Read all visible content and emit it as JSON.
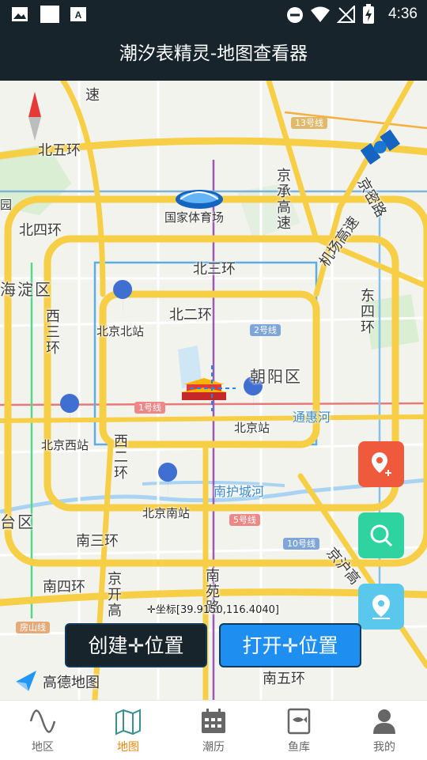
{
  "status_bar": {
    "time": "4:36"
  },
  "title_bar": {
    "title": "潮汐表精灵-地图查看器"
  },
  "map": {
    "ring_roads": {
      "north_5th": "北五环",
      "north_4th": "北四环",
      "north_3rd": "北三环",
      "north_2nd": "北二环",
      "east_4th": "东四环",
      "west_3rd": "西三环",
      "west_2nd": "西二环",
      "south_3rd": "南三环",
      "south_4th": "南四环",
      "south_5th": "南五环"
    },
    "expressways": {
      "jingcheng": "京承高速",
      "airport": "机场高速",
      "jingmi": "京密路",
      "jinghu": "京沪高",
      "jingkai": "京开高",
      "nanyuan": "南苑路",
      "jing_top": "速"
    },
    "districts": {
      "haidian": "海淀区",
      "chaoyang": "朝阳区",
      "fengtai": "台区",
      "edge_west": "园"
    },
    "landmarks": {
      "stadium": "国家体育场"
    },
    "stations": {
      "beijing_north": "北京北站",
      "beijing": "北京站",
      "beijing_west": "北京西站",
      "beijing_south": "北京南站"
    },
    "water": {
      "tonghui": "通惠河",
      "nanhucheng": "南护城河"
    },
    "metro_lines": {
      "line13": "13号线",
      "line2": "2号线",
      "line1": "1号线",
      "line5": "5号线",
      "line10": "10号线",
      "fangshan": "房山线"
    },
    "coordinate_label": "✛坐标[39.9150,116.4040]",
    "logo_text": "高德地图"
  },
  "fabs": [
    {
      "icon": "add-location-icon",
      "color": "#f05a3c"
    },
    {
      "icon": "search-icon",
      "color": "#2ed3a0"
    },
    {
      "icon": "location-icon",
      "color": "#5ac8ec"
    }
  ],
  "buttons": {
    "create": "创建✛位置",
    "open": "打开✛位置"
  },
  "tabs": [
    {
      "label": "地区",
      "icon": "wave-icon",
      "active": false
    },
    {
      "label": "地图",
      "icon": "map-icon",
      "active": true
    },
    {
      "label": "潮历",
      "icon": "calendar-icon",
      "active": false
    },
    {
      "label": "鱼库",
      "icon": "fish-book-icon",
      "active": false
    },
    {
      "label": "我的",
      "icon": "user-icon",
      "active": false
    }
  ],
  "colors": {
    "header": "#17242c",
    "active_tab": "#e8870e",
    "create_button": "#17242c",
    "open_button": "#1e8ef0"
  }
}
